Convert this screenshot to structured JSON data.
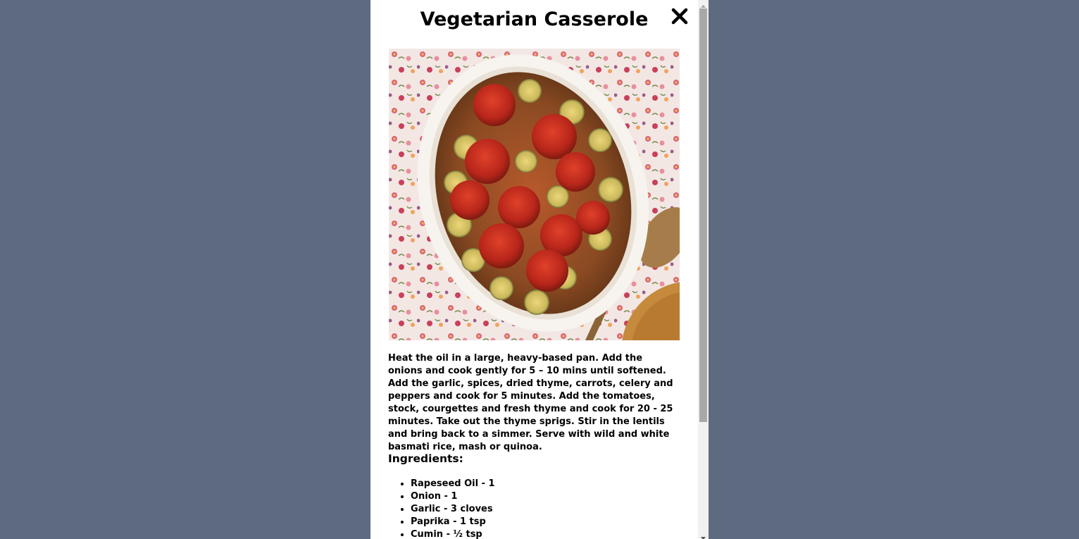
{
  "modal": {
    "title": "Vegetarian Casserole",
    "close_icon": "close-icon",
    "image_alt": "casserole-dish-photo",
    "method": "Heat the oil in a large, heavy-based pan. Add the onions and cook gently for 5 – 10 mins until softened. Add the garlic, spices, dried thyme, carrots, celery and peppers and cook for 5 minutes. Add the tomatoes, stock, courgettes and fresh thyme and cook for 20 - 25 minutes. Take out the thyme sprigs. Stir in the lentils and bring back to a simmer. Serve with wild and white basmati rice, mash or quinoa.",
    "ingredients_heading": "Ingredients:",
    "ingredients": [
      "Rapeseed Oil - 1",
      "Onion - 1",
      "Garlic - 3 cloves",
      "Paprika - 1 tsp",
      "Cumin - ½ tsp"
    ]
  },
  "colors": {
    "backdrop": "#5e6a7f",
    "modal_bg": "#ffffff",
    "text": "#000000",
    "scroll_thumb": "#a8a8a8"
  }
}
